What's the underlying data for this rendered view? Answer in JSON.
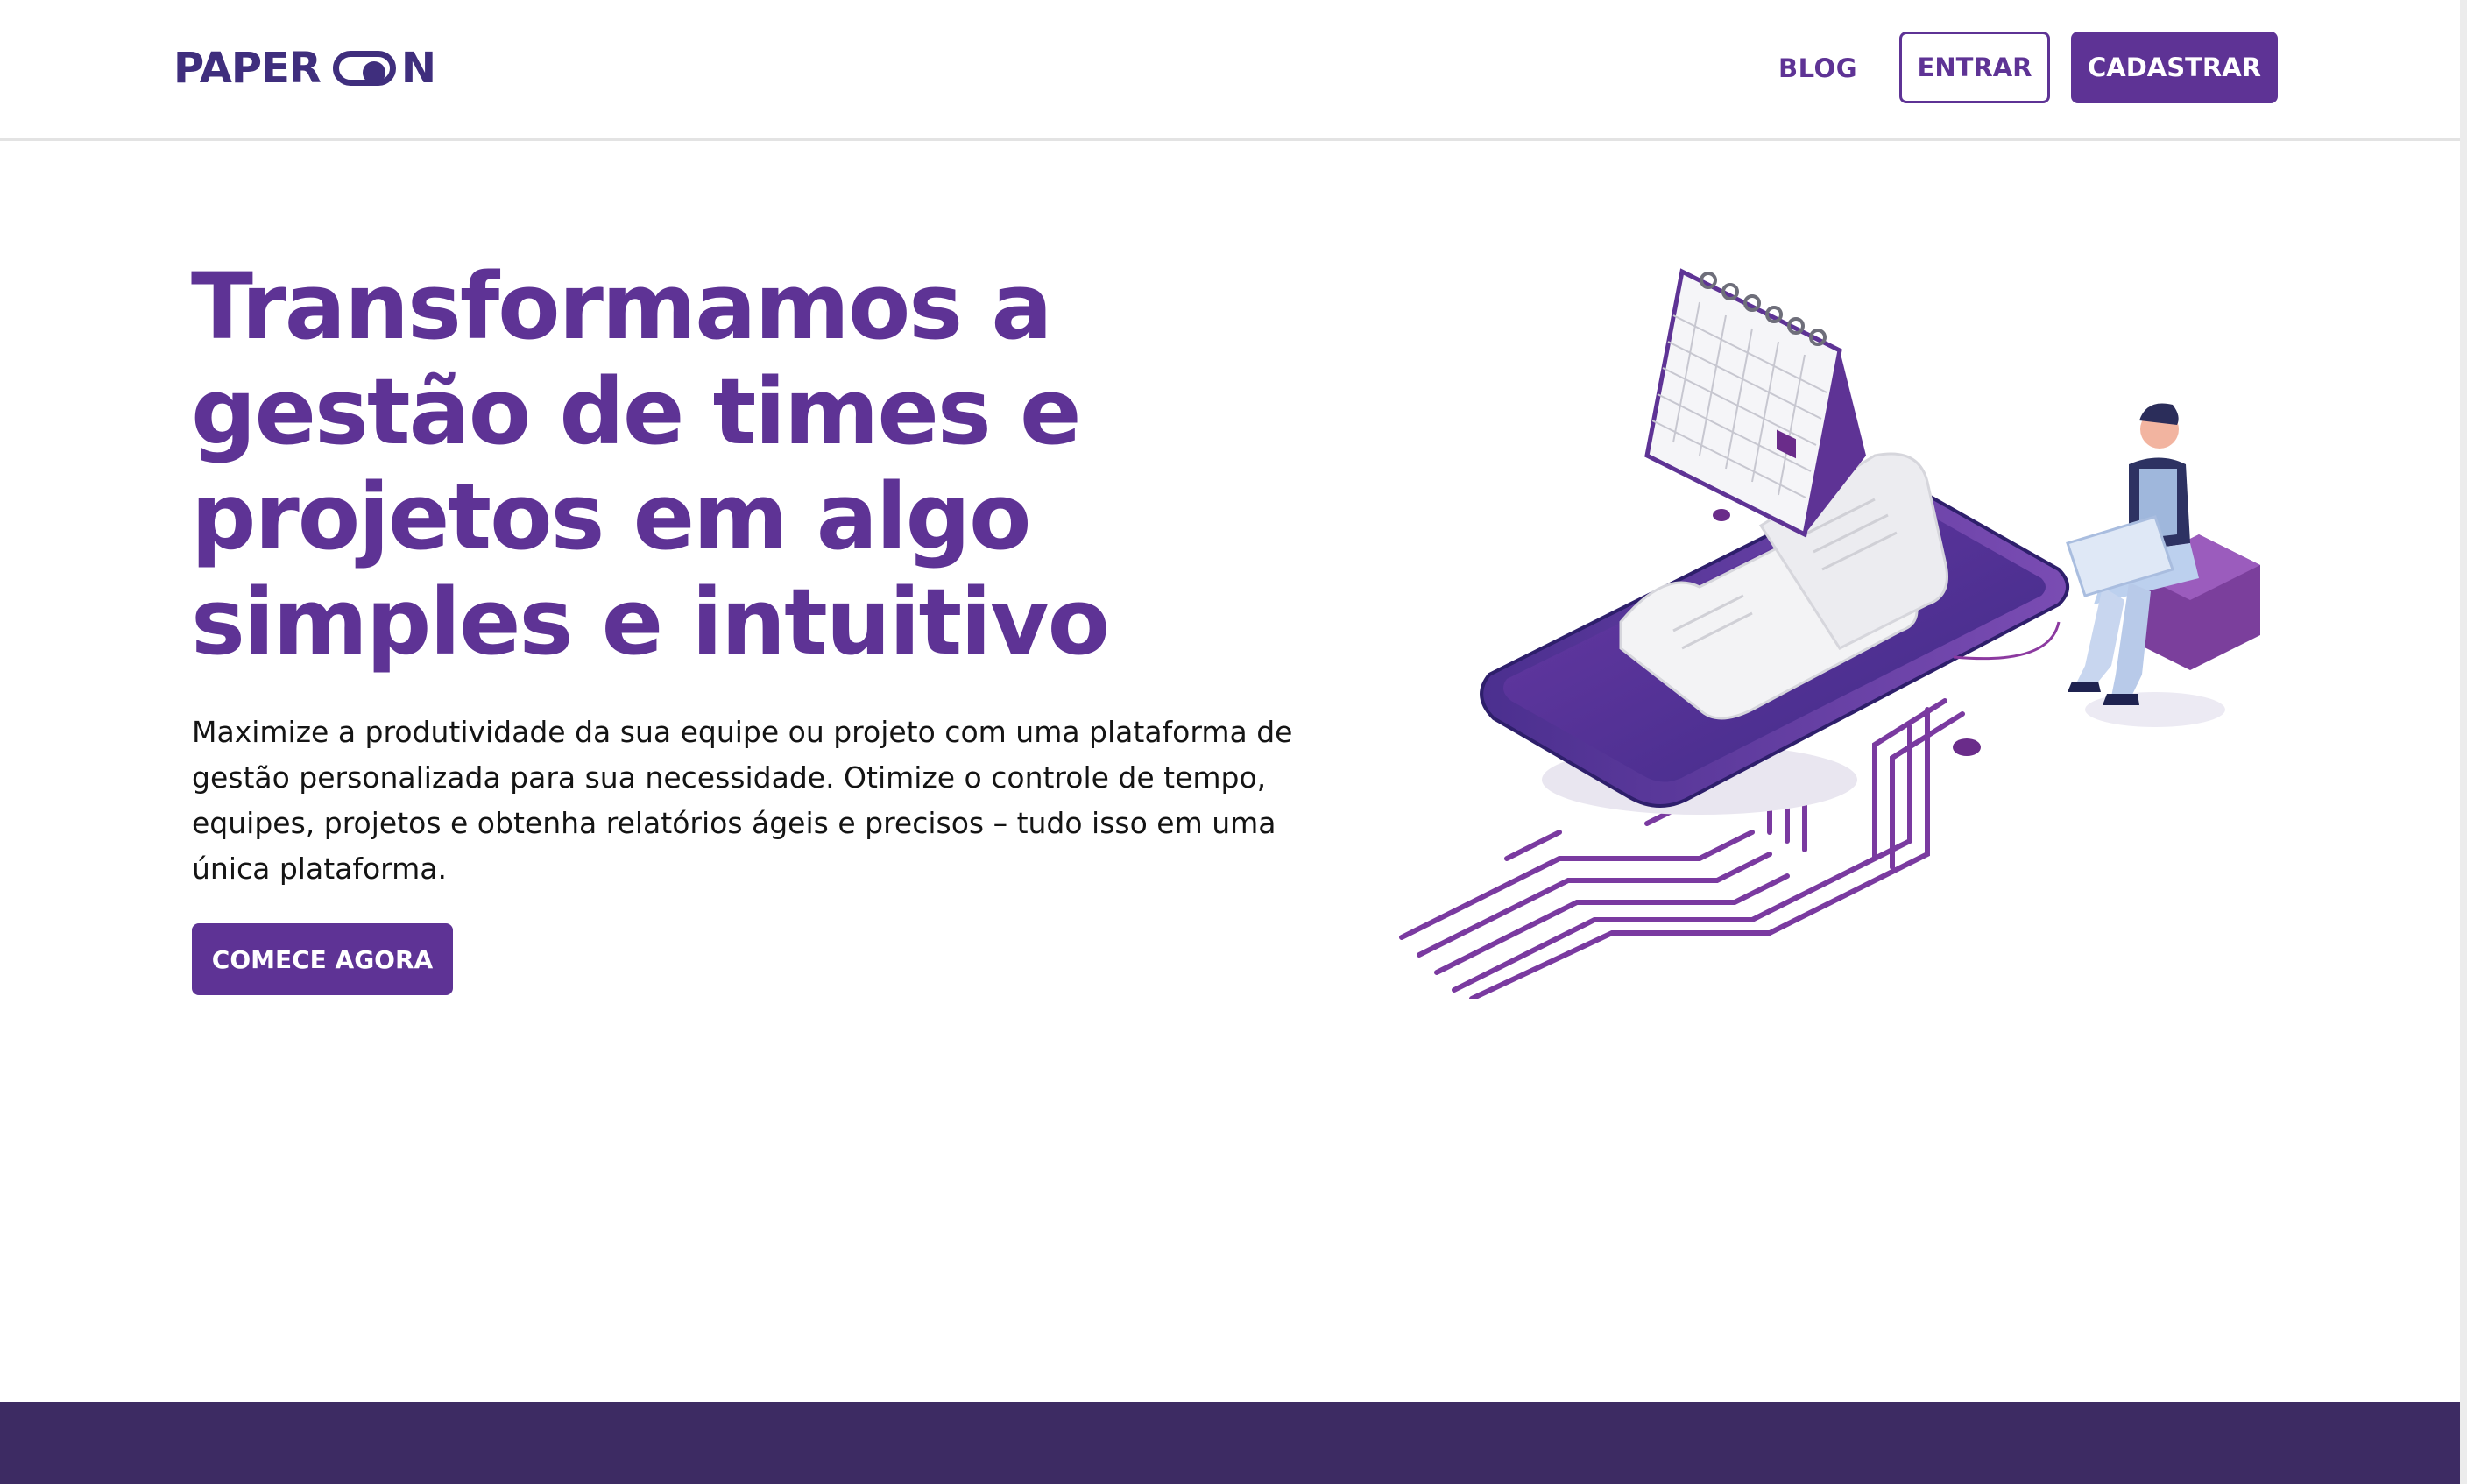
{
  "header": {
    "logo_text_left": "PAPER",
    "logo_text_right": "N",
    "nav_blog": "BLOG",
    "login_label": "ENTRAR",
    "signup_label": "CADASTRAR"
  },
  "hero": {
    "title_line1": "Transformamos a",
    "title_line2": "gestão de times e",
    "title_line3": "projetos em algo",
    "title_line4": "simples e intuitivo",
    "description": "Maximize a produtividade da sua equipe ou projeto com uma plataforma de gestão personalizada para sua necessidade. Otimize o controle de tempo, equipes, projetos e obtenha relatórios ágeis e precisos – tudo isso em uma única plataforma.",
    "cta_label": "COMECE AGORA"
  },
  "colors": {
    "brand_purple": "#5e3395",
    "logo_purple": "#3f2e7d",
    "footer_band": "#3d2b63"
  },
  "icons": {
    "logo_toggle": "toggle-switch-icon",
    "illustration": "phone-calendar-receipt-person-illustration"
  }
}
